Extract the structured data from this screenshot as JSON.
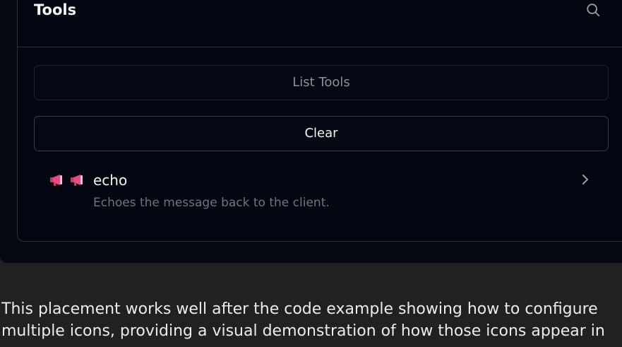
{
  "panel": {
    "title": "Tools",
    "list_tools_label": "List Tools",
    "clear_label": "Clear"
  },
  "tools": [
    {
      "name": "echo",
      "description": "Echoes the message back to the client.",
      "icons": [
        "megaphone-icon",
        "megaphone-icon"
      ]
    }
  ],
  "article": {
    "text": "This placement works well after the code example showing how to configure multiple icons, providing a visual demonstration of how those icons appear in"
  },
  "colors": {
    "page_background": "#212121",
    "panel_background": "#020611",
    "border": "#2a313d",
    "text_primary": "#f3f4f6",
    "text_muted": "#6e7480",
    "icon_accent": "#ec4a7c"
  }
}
